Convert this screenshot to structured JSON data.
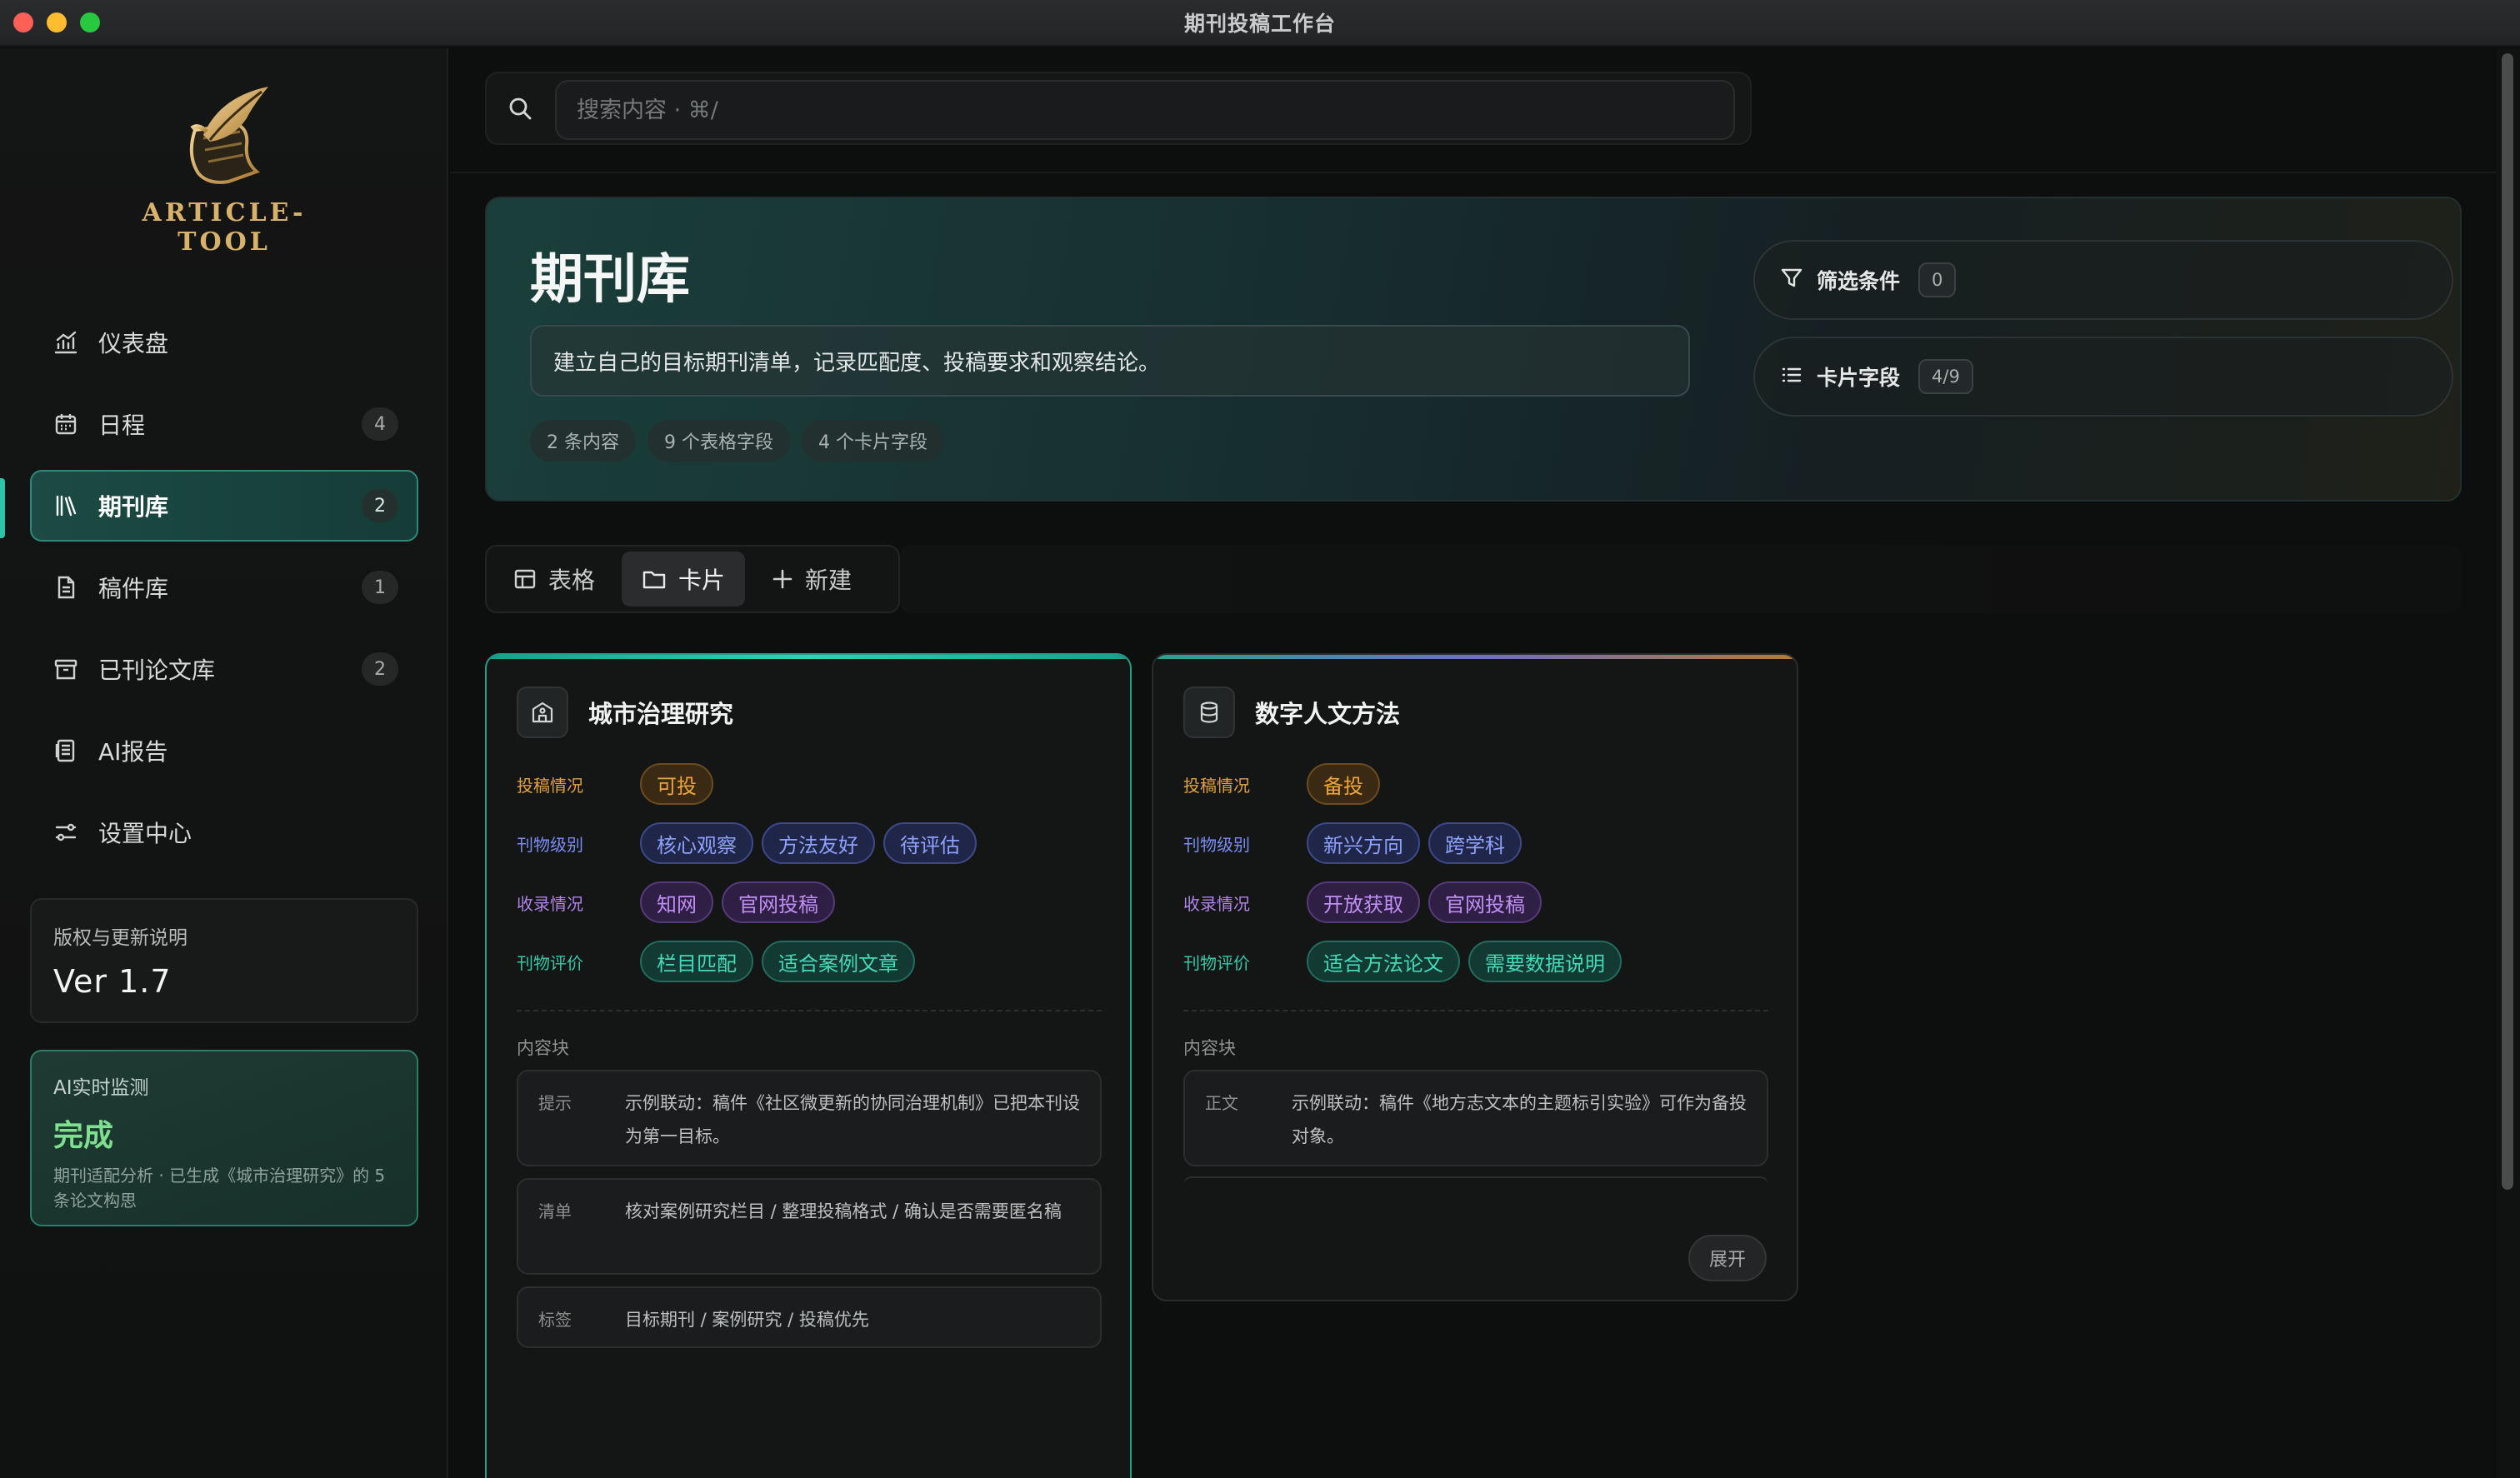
{
  "window": {
    "title": "期刊投稿工作台"
  },
  "sidebar": {
    "logo_text": "ARTICLE-TOOL",
    "items": [
      {
        "label": "仪表盘",
        "icon": "chart-icon",
        "badge": ""
      },
      {
        "label": "日程",
        "icon": "calendar-icon",
        "badge": "4"
      },
      {
        "label": "期刊库",
        "icon": "library-icon",
        "badge": "2",
        "active": true
      },
      {
        "label": "稿件库",
        "icon": "document-icon",
        "badge": "1"
      },
      {
        "label": "已刊论文库",
        "icon": "archive-icon",
        "badge": "2"
      },
      {
        "label": "AI报告",
        "icon": "report-icon",
        "badge": ""
      },
      {
        "label": "设置中心",
        "icon": "settings-sliders-icon",
        "badge": ""
      }
    ],
    "version": {
      "label": "版权与更新说明",
      "value": "Ver 1.7"
    },
    "ai_monitor": {
      "label": "AI实时监测",
      "status": "完成",
      "description": "期刊适配分析 · 已生成《城市治理研究》的 5 条论文构思"
    }
  },
  "search": {
    "placeholder": "搜索内容 · ⌘/"
  },
  "hero": {
    "title": "期刊库",
    "description": "建立自己的目标期刊清单，记录匹配度、投稿要求和观察结论。",
    "stats": [
      "2 条内容",
      "9 个表格字段",
      "4 个卡片字段"
    ],
    "filter": {
      "label": "筛选条件",
      "count": "0"
    },
    "card_fields": {
      "label": "卡片字段",
      "count": "4/9"
    }
  },
  "view_toggle": {
    "table": "表格",
    "card": "卡片",
    "new": "新建"
  },
  "cards": [
    {
      "title": "城市治理研究",
      "icon": "building-icon",
      "fields": [
        {
          "label": "投稿情况",
          "tags": [
            "可投"
          ]
        },
        {
          "label": "刊物级别",
          "tags": [
            "核心观察",
            "方法友好",
            "待评估"
          ]
        },
        {
          "label": "收录情况",
          "tags": [
            "知网",
            "官网投稿"
          ]
        },
        {
          "label": "刊物评价",
          "tags": [
            "栏目匹配",
            "适合案例文章"
          ]
        }
      ],
      "block_title": "内容块",
      "blocks": [
        {
          "key": "提示",
          "value": "示例联动：稿件《社区微更新的协同治理机制》已把本刊设为第一目标。"
        },
        {
          "key": "清单",
          "value": "核对案例研究栏目 / 整理投稿格式 / 确认是否需要匿名稿"
        },
        {
          "key": "标签",
          "value": "目标期刊 / 案例研究 / 投稿优先"
        }
      ]
    },
    {
      "title": "数字人文方法",
      "icon": "database-icon",
      "fields": [
        {
          "label": "投稿情况",
          "tags": [
            "备投"
          ]
        },
        {
          "label": "刊物级别",
          "tags": [
            "新兴方向",
            "跨学科"
          ]
        },
        {
          "label": "收录情况",
          "tags": [
            "开放获取",
            "官网投稿"
          ]
        },
        {
          "label": "刊物评价",
          "tags": [
            "适合方法论文",
            "需要数据说明"
          ]
        }
      ],
      "block_title": "内容块",
      "blocks": [
        {
          "key": "正文",
          "value": "示例联动：稿件《地方志文本的主题标引实验》可作为备投对象。"
        }
      ],
      "expand_label": "展开"
    }
  ],
  "colors": {
    "accent": "#2fc3a8",
    "orange": "#f0a43c",
    "blue": "#8ea1ff",
    "purple": "#c08ef5",
    "teal": "#45d9b8"
  }
}
